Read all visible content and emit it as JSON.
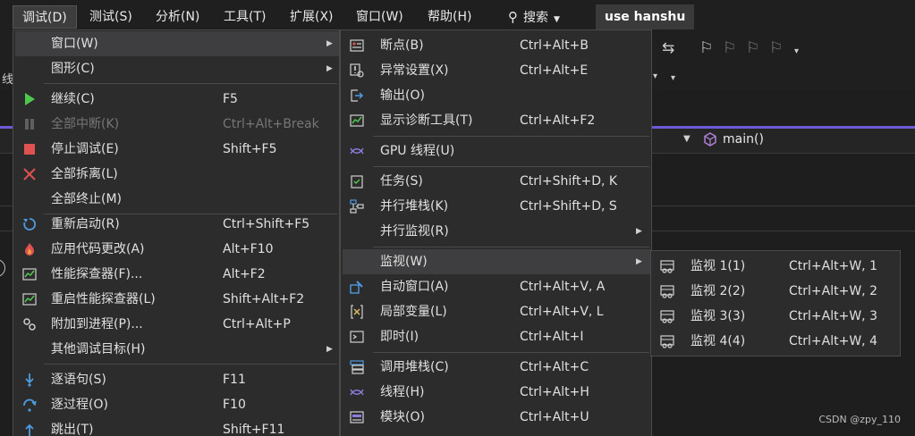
{
  "menubar": {
    "items": [
      {
        "label": "调试(D)",
        "active": true
      },
      {
        "label": "测试(S)"
      },
      {
        "label": "分析(N)"
      },
      {
        "label": "工具(T)"
      },
      {
        "label": "扩展(X)"
      },
      {
        "label": "窗口(W)"
      },
      {
        "label": "帮助(H)"
      }
    ],
    "search_label": "搜索",
    "solution_name": "use hanshu"
  },
  "background": {
    "left_label": "线",
    "nav_function": "main()"
  },
  "debug_menu": {
    "items": [
      {
        "label": "窗口(W)",
        "icon": "none",
        "submenu": true,
        "highlighted": true
      },
      {
        "label": "图形(C)",
        "icon": "none",
        "submenu": true
      },
      {
        "label": "继续(C)",
        "icon": "play-icon",
        "shortcut": "F5"
      },
      {
        "label": "全部中断(K)",
        "icon": "pause-icon",
        "shortcut": "Ctrl+Alt+Break",
        "disabled": true
      },
      {
        "label": "停止调试(E)",
        "icon": "stop-icon",
        "shortcut": "Shift+F5"
      },
      {
        "label": "全部拆离(L)",
        "icon": "detach-icon"
      },
      {
        "label": "全部终止(M)",
        "icon": "none"
      },
      {
        "label": "重新启动(R)",
        "icon": "restart-icon",
        "shortcut": "Ctrl+Shift+F5"
      },
      {
        "label": "应用代码更改(A)",
        "icon": "hot-reload-icon",
        "shortcut": "Alt+F10"
      },
      {
        "label": "性能探查器(F)...",
        "icon": "profiler-icon",
        "shortcut": "Alt+F2"
      },
      {
        "label": "重启性能探查器(L)",
        "icon": "profiler-restart-icon",
        "shortcut": "Shift+Alt+F2"
      },
      {
        "label": "附加到进程(P)...",
        "icon": "attach-process-icon",
        "shortcut": "Ctrl+Alt+P"
      },
      {
        "label": "其他调试目标(H)",
        "icon": "none",
        "submenu": true
      },
      {
        "label": "逐语句(S)",
        "icon": "step-into-icon",
        "shortcut": "F11"
      },
      {
        "label": "逐过程(O)",
        "icon": "step-over-icon",
        "shortcut": "F10"
      },
      {
        "label": "跳出(T)",
        "icon": "step-out-icon",
        "shortcut": "Shift+F11"
      }
    ]
  },
  "window_menu": {
    "items": [
      {
        "label": "断点(B)",
        "icon": "breakpoints-icon",
        "shortcut": "Ctrl+Alt+B"
      },
      {
        "label": "异常设置(X)",
        "icon": "exception-settings-icon",
        "shortcut": "Ctrl+Alt+E"
      },
      {
        "label": "输出(O)",
        "icon": "output-icon"
      },
      {
        "label": "显示诊断工具(T)",
        "icon": "diagnostic-tools-icon",
        "shortcut": "Ctrl+Alt+F2"
      },
      {
        "label": "GPU 线程(U)",
        "icon": "gpu-threads-icon"
      },
      {
        "label": "任务(S)",
        "icon": "tasks-icon",
        "shortcut": "Ctrl+Shift+D, K"
      },
      {
        "label": "并行堆栈(K)",
        "icon": "parallel-stacks-icon",
        "shortcut": "Ctrl+Shift+D, S"
      },
      {
        "label": "并行监视(R)",
        "icon": "none",
        "submenu": true
      },
      {
        "label": "监视(W)",
        "icon": "none",
        "submenu": true,
        "highlighted": true
      },
      {
        "label": "自动窗口(A)",
        "icon": "autos-icon",
        "shortcut": "Ctrl+Alt+V, A"
      },
      {
        "label": "局部变量(L)",
        "icon": "locals-icon",
        "shortcut": "Ctrl+Alt+V, L"
      },
      {
        "label": "即时(I)",
        "icon": "immediate-icon",
        "shortcut": "Ctrl+Alt+I"
      },
      {
        "label": "调用堆栈(C)",
        "icon": "call-stack-icon",
        "shortcut": "Ctrl+Alt+C"
      },
      {
        "label": "线程(H)",
        "icon": "threads-icon",
        "shortcut": "Ctrl+Alt+H"
      },
      {
        "label": "模块(O)",
        "icon": "modules-icon",
        "shortcut": "Ctrl+Alt+U"
      }
    ]
  },
  "watch_menu": {
    "items": [
      {
        "label": "监视 1(1)",
        "icon": "watch-icon",
        "shortcut": "Ctrl+Alt+W, 1"
      },
      {
        "label": "监视 2(2)",
        "icon": "watch-icon",
        "shortcut": "Ctrl+Alt+W, 2"
      },
      {
        "label": "监视 3(3)",
        "icon": "watch-icon",
        "shortcut": "Ctrl+Alt+W, 3"
      },
      {
        "label": "监视 4(4)",
        "icon": "watch-icon",
        "shortcut": "Ctrl+Alt+W, 4"
      }
    ]
  },
  "watermark": "CSDN @zpy_110",
  "colors": {
    "accent_purple": "#6b5bd6",
    "play_green": "#4ec94e",
    "stop_red": "#e05252",
    "icon_blue": "#4f9be0"
  }
}
